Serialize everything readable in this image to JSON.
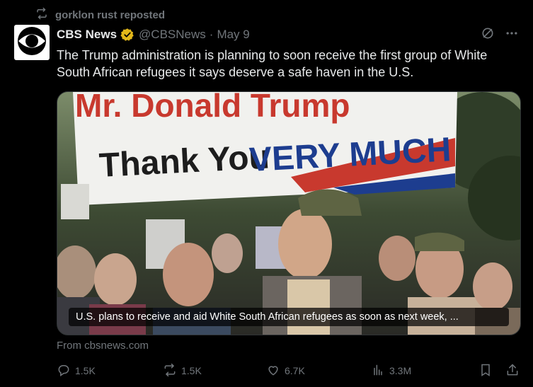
{
  "repost": {
    "text": "gorklon rust reposted"
  },
  "tweet": {
    "author_name": "CBS News",
    "handle": "@CBSNews",
    "separator": "·",
    "date": "May 9",
    "text": "The Trump administration is planning to soon receive the first group of White South African refugees  it says deserve a safe haven in the U.S.",
    "media": {
      "banner_top": "Mr. Donald Trump",
      "banner_line1": "Thank You",
      "banner_line2": "VERY MUCH",
      "caption": "U.S. plans to receive and aid White South African refugees as soon as next week, ..."
    },
    "source": "From cbsnews.com"
  },
  "actions": {
    "replies": "1.5K",
    "reposts": "1.5K",
    "likes": "6.7K",
    "views": "3.3M"
  },
  "colors": {
    "background": "#000000",
    "text": "#e7e9ea",
    "muted": "#71767b",
    "verified_gold": "#e2b719"
  }
}
